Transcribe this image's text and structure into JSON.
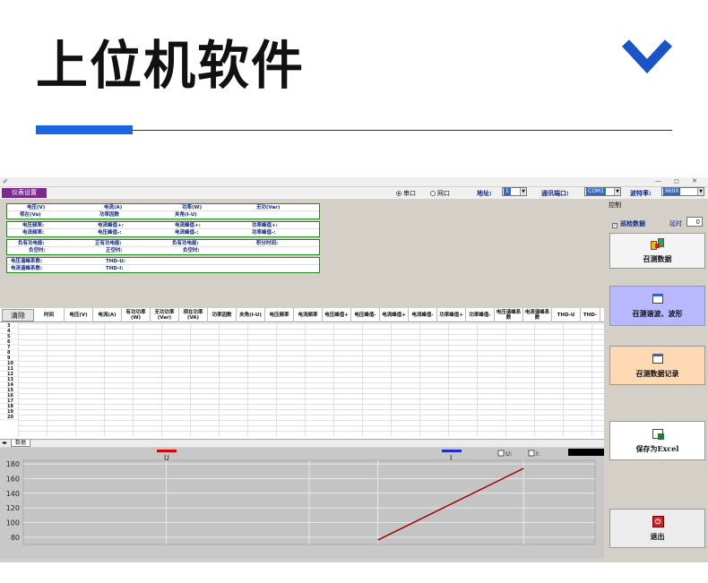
{
  "hero": {
    "title": "上位机软件"
  },
  "window": {
    "icon": "app-icon",
    "controls": "— ◻ ✕"
  },
  "topbar": {
    "meter_settings": "仪表设置",
    "radio_serial": "串口",
    "radio_network": "网口",
    "address_label": "地址:",
    "address_value": "1",
    "port_label": "通讯端口:",
    "port_value": "COM1",
    "baud_label": "波特率:",
    "baud_value": "9600"
  },
  "measurements": {
    "r1": [
      "电压(V)",
      "电流(A)",
      "功率(W)",
      "无功(Var)"
    ],
    "r2": [
      "视在(Va)",
      "功率因数",
      "夹角(I-U)"
    ],
    "r3": [
      "电压频率:",
      "电流峰值+:",
      "电流峰值+:",
      "功率峰值+:"
    ],
    "r4": [
      "电流频率:",
      "电压峰值-:",
      "电流峰值-:",
      "功率峰值-:"
    ],
    "r5": [
      "负有功电能:",
      "正有功电能:",
      "负有功电能:",
      "积分时间:"
    ],
    "r6": [
      "负空时:",
      "正空时:",
      "负空时:"
    ],
    "r7": [
      "电压谐峰系数:",
      "THD-U:"
    ],
    "r8": [
      "电流谐峰系数:",
      "THD-I:"
    ]
  },
  "table": {
    "clear_button": "清除",
    "headers": [
      "时间",
      "电压(V)",
      "电流(A)",
      "有功功率(W)",
      "无功功率(Var)",
      "视在功率(VA)",
      "功率因数",
      "夹角(I-U)",
      "电压频率",
      "电流频率",
      "电压峰值+",
      "电压峰值-",
      "电流峰值+",
      "电流峰值-",
      "功率峰值+",
      "功率峰值-",
      "电压谐峰系数",
      "电流谐峰系数",
      "THD-U",
      "THD-"
    ],
    "row_numbers": [
      "3",
      "4",
      "5",
      "6",
      "7",
      "8",
      "9",
      "10",
      "11",
      "12",
      "13",
      "14",
      "15",
      "16",
      "17",
      "18",
      "19",
      "20"
    ],
    "sheet_tab": "数据"
  },
  "chart_legend": {
    "u_label": "U",
    "i_label": "I",
    "u_check": "U:",
    "i_check": "I:"
  },
  "chart_data": {
    "type": "line",
    "title": "",
    "xlabel": "",
    "ylabel": "",
    "ylim": [
      70,
      185
    ],
    "yticks": [
      80,
      100,
      120,
      140,
      160,
      180
    ],
    "grid": true,
    "colors": {
      "line": "#a00000",
      "u_marker": "#e00000",
      "i_marker": "#1a2fd0"
    },
    "series": [
      {
        "name": "I",
        "x": [
          0.62,
          0.875
        ],
        "y": [
          76,
          174
        ]
      }
    ]
  },
  "control": {
    "title": "控制",
    "poll_label": "巡检数据",
    "delay_label": "延时",
    "delay_value": "0",
    "btn_fetch": "召测数据",
    "btn_harmonic": "召测谐波、波形",
    "btn_records": "召测数据记录",
    "btn_excel": "保存为Excel",
    "btn_exit": "退出"
  }
}
